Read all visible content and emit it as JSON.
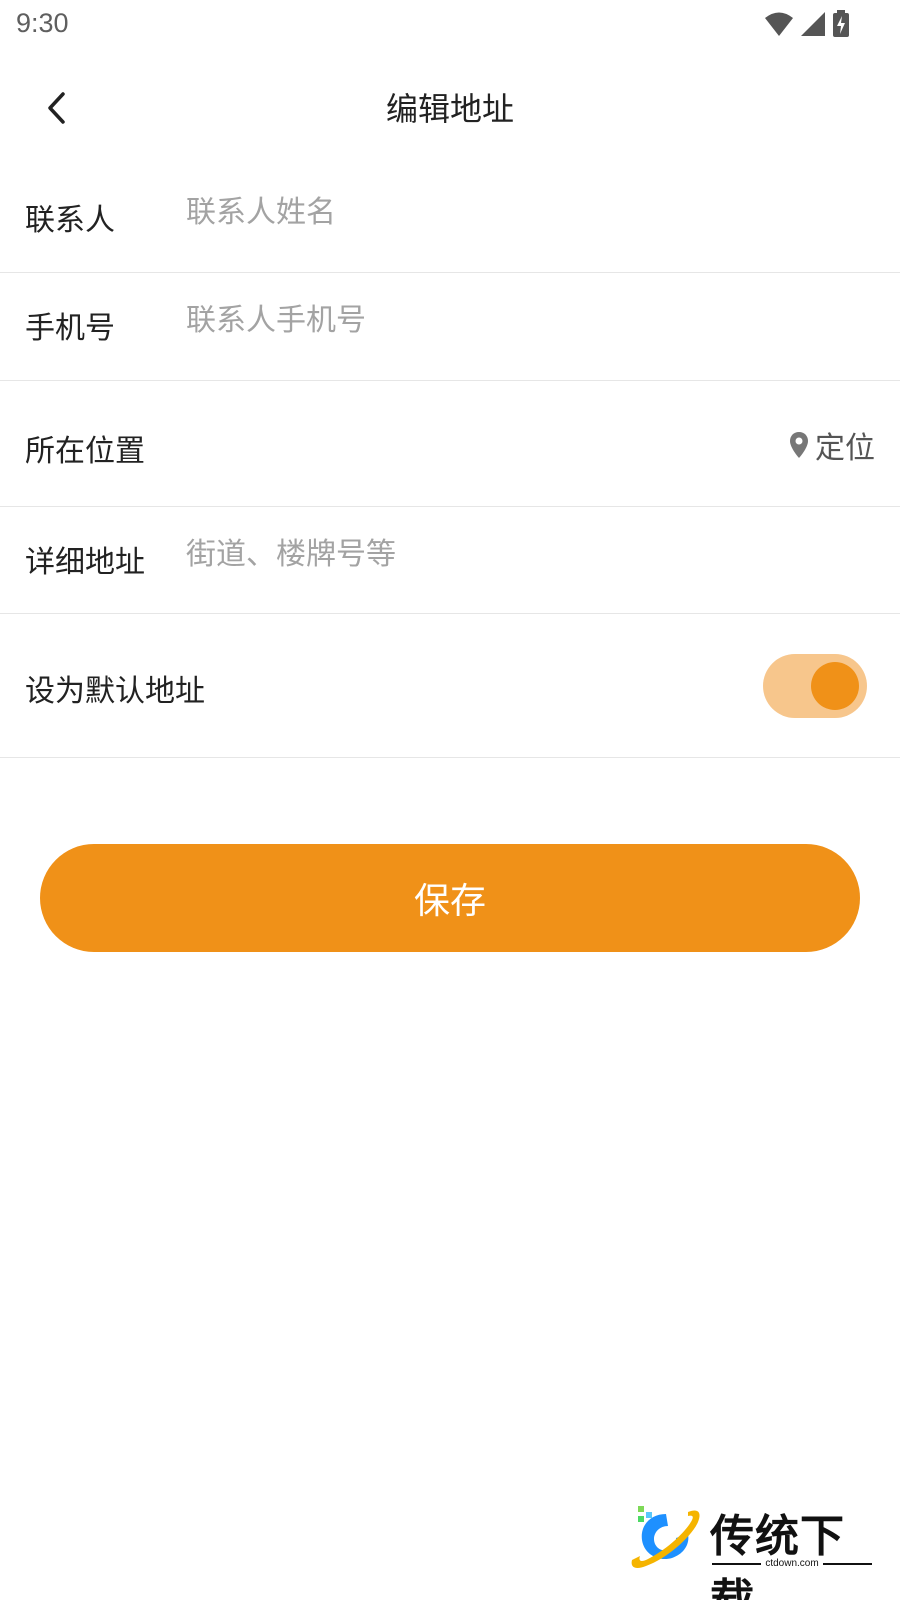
{
  "status_bar": {
    "time": "9:30"
  },
  "header": {
    "title": "编辑地址"
  },
  "form": {
    "contact": {
      "label": "联系人",
      "placeholder": "联系人姓名",
      "value": ""
    },
    "phone": {
      "label": "手机号",
      "placeholder": "联系人手机号",
      "value": ""
    },
    "location": {
      "label": "所在位置",
      "locate_label": "定位"
    },
    "detail": {
      "label": "详细地址",
      "placeholder": "街道、楼牌号等",
      "value": ""
    },
    "default_address": {
      "label": "设为默认地址",
      "enabled": true
    }
  },
  "save_button": {
    "label": "保存"
  },
  "watermark": {
    "name": "传统下载",
    "domain": "ctdown.com"
  },
  "colors": {
    "accent": "#f09118",
    "toggle_track": "#f7c68c",
    "divider": "#e6e6e6",
    "placeholder": "#a3a3a3"
  },
  "icons": [
    "chevron-left-icon",
    "wifi-icon",
    "cellular-signal-icon",
    "battery-charging-icon",
    "location-pin-icon"
  ]
}
